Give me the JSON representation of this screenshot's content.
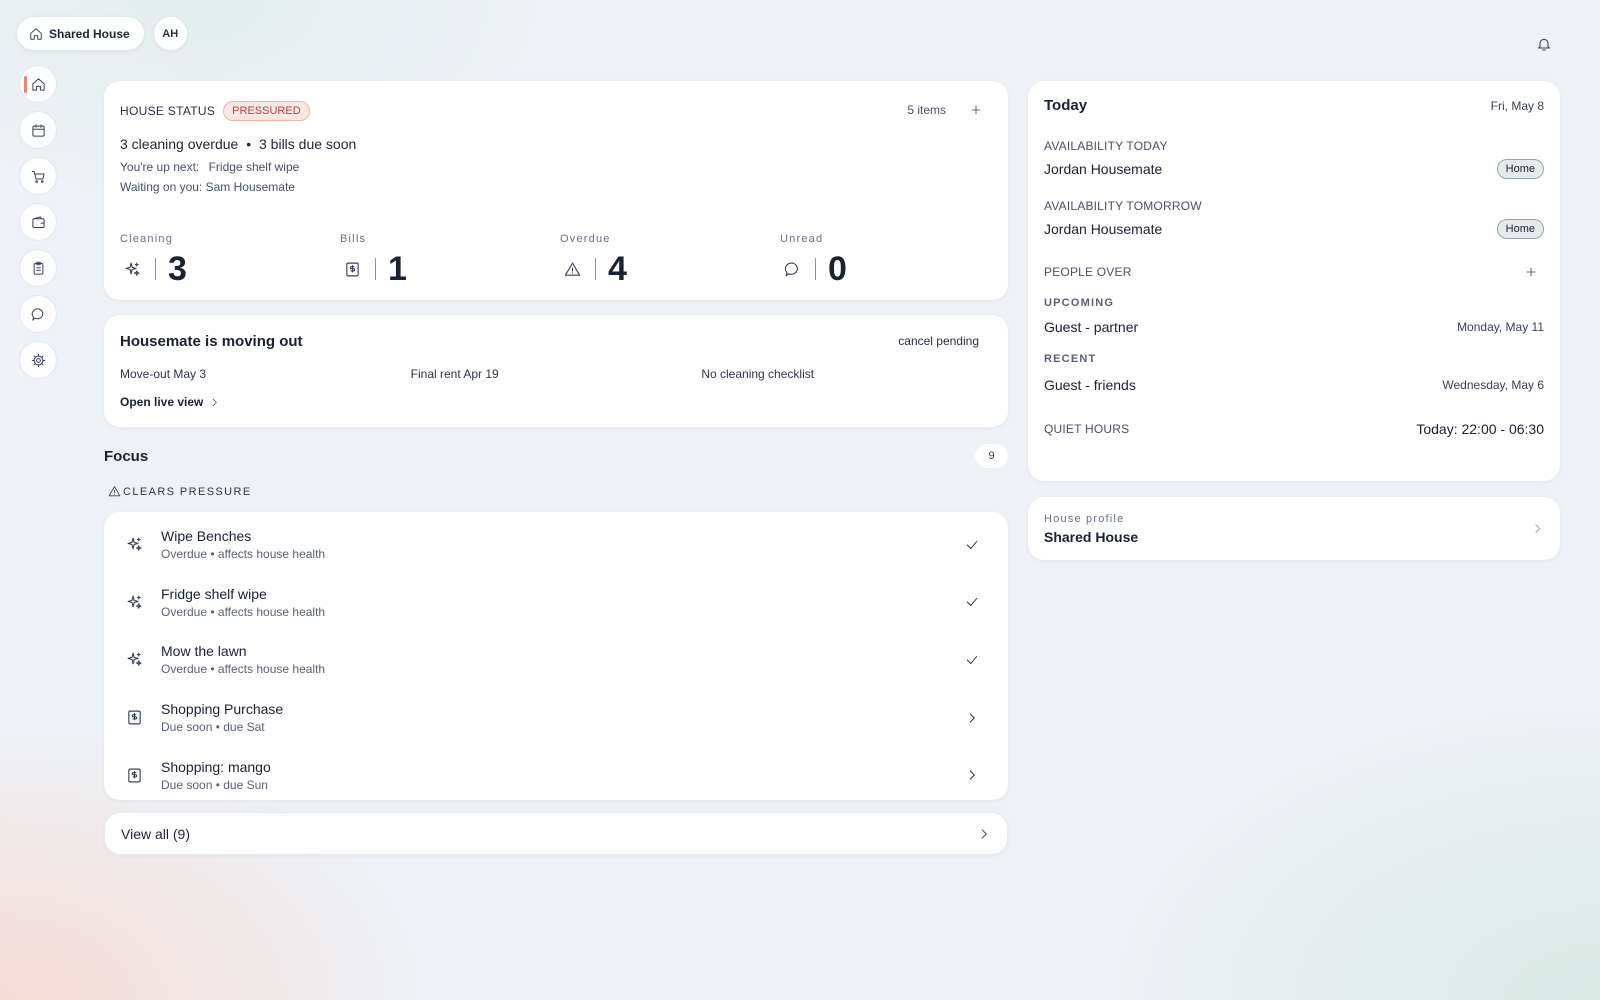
{
  "topbar": {
    "house_name": "Shared House",
    "avatar_initials": "AH"
  },
  "status": {
    "label": "HOUSE STATUS",
    "badge": "PRESSURED",
    "items_count": "5 items",
    "summary_left": "3 cleaning overdue",
    "summary_sep": "•",
    "summary_right": "3 bills due soon",
    "next_label": "You're up next:",
    "next_value": "Fridge shelf wipe",
    "waiting": "Waiting on you: Sam Housemate",
    "metrics": [
      {
        "label": "Cleaning",
        "value": "3",
        "icon": "sparkles-icon"
      },
      {
        "label": "Bills",
        "value": "1",
        "icon": "receipt-icon"
      },
      {
        "label": "Overdue",
        "value": "4",
        "icon": "warning-icon"
      },
      {
        "label": "Unread",
        "value": "0",
        "icon": "chat-icon"
      }
    ]
  },
  "moveout": {
    "title": "Housemate is moving out",
    "status": "cancel pending",
    "details": [
      "Move-out May 3",
      "Final rent Apr 19",
      "No cleaning checklist"
    ],
    "link": "Open live view"
  },
  "focus": {
    "title": "Focus",
    "count": "9",
    "section_label": "CLEARS PRESSURE",
    "tasks": [
      {
        "title": "Wipe Benches",
        "sub": "Overdue • affects house health",
        "icon": "sparkles-icon",
        "action": "check-icon"
      },
      {
        "title": "Fridge shelf wipe",
        "sub": "Overdue • affects house health",
        "icon": "sparkles-icon",
        "action": "check-icon"
      },
      {
        "title": "Mow the lawn",
        "sub": "Overdue • affects house health",
        "icon": "sparkles-icon",
        "action": "check-icon"
      },
      {
        "title": "Shopping Purchase",
        "sub": "Due soon • due Sat",
        "icon": "receipt-icon",
        "action": "chevron-right-icon"
      },
      {
        "title": "Shopping: mango",
        "sub": "Due soon • due Sun",
        "icon": "receipt-icon",
        "action": "chevron-right-icon"
      }
    ],
    "view_all": "View all (9)"
  },
  "today": {
    "title": "Today",
    "date": "Fri, May 8",
    "availability_today_label": "AVAILABILITY TODAY",
    "availability_today": {
      "name": "Jordan Housemate",
      "status": "Home"
    },
    "availability_tomorrow_label": "AVAILABILITY TOMORROW",
    "availability_tomorrow": {
      "name": "Jordan Housemate",
      "status": "Home"
    },
    "people_over_label": "PEOPLE OVER",
    "upcoming_label": "UPCOMING",
    "upcoming": {
      "name": "Guest - partner",
      "date": "Monday, May 11"
    },
    "recent_label": "RECENT",
    "recent": {
      "name": "Guest - friends",
      "date": "Wednesday, May 6"
    },
    "quiet_label": "QUIET HOURS",
    "quiet_value": "Today: 22:00 - 06:30"
  },
  "profile": {
    "label": "House profile",
    "name": "Shared House"
  },
  "colors": {
    "accent": "#e9847a",
    "badge_red": "#b2463c",
    "text": "#1b2230"
  }
}
